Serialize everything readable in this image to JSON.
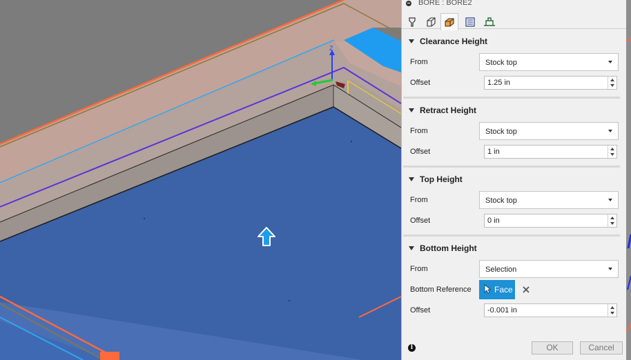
{
  "dialog": {
    "title": "BORE : BORE2",
    "tabs": [
      {
        "icon": "tool-icon"
      },
      {
        "icon": "geometry-icon"
      },
      {
        "icon": "heights-icon"
      },
      {
        "icon": "passes-icon"
      },
      {
        "icon": "linking-icon"
      }
    ],
    "active_tab": 2
  },
  "sections": {
    "clearance": {
      "title": "Clearance Height",
      "from_label": "From",
      "from_value": "Stock top",
      "offset_label": "Offset",
      "offset_value": "1.25 in"
    },
    "retract": {
      "title": "Retract Height",
      "from_label": "From",
      "from_value": "Stock top",
      "offset_label": "Offset",
      "offset_value": "1 in"
    },
    "top": {
      "title": "Top Height",
      "from_label": "From",
      "from_value": "Stock top",
      "offset_label": "Offset",
      "offset_value": "0 in"
    },
    "bottom": {
      "title": "Bottom Height",
      "from_label": "From",
      "from_value": "Selection",
      "reference_label": "Bottom Reference",
      "reference_button": "Face",
      "offset_label": "Offset",
      "offset_value": "-0.001 in"
    }
  },
  "footer": {
    "ok_label": "OK",
    "cancel_label": "Cancel"
  },
  "viewport": {
    "axis_label": "Z",
    "colors": {
      "face": "#3c62a8",
      "wall": "#a59a94",
      "stock_top": "#bfa29a",
      "orange": "#ff6a3c",
      "olive": "#8a7a3c",
      "light_blue": "#2ea6ee",
      "purple": "#5a33d8"
    }
  }
}
